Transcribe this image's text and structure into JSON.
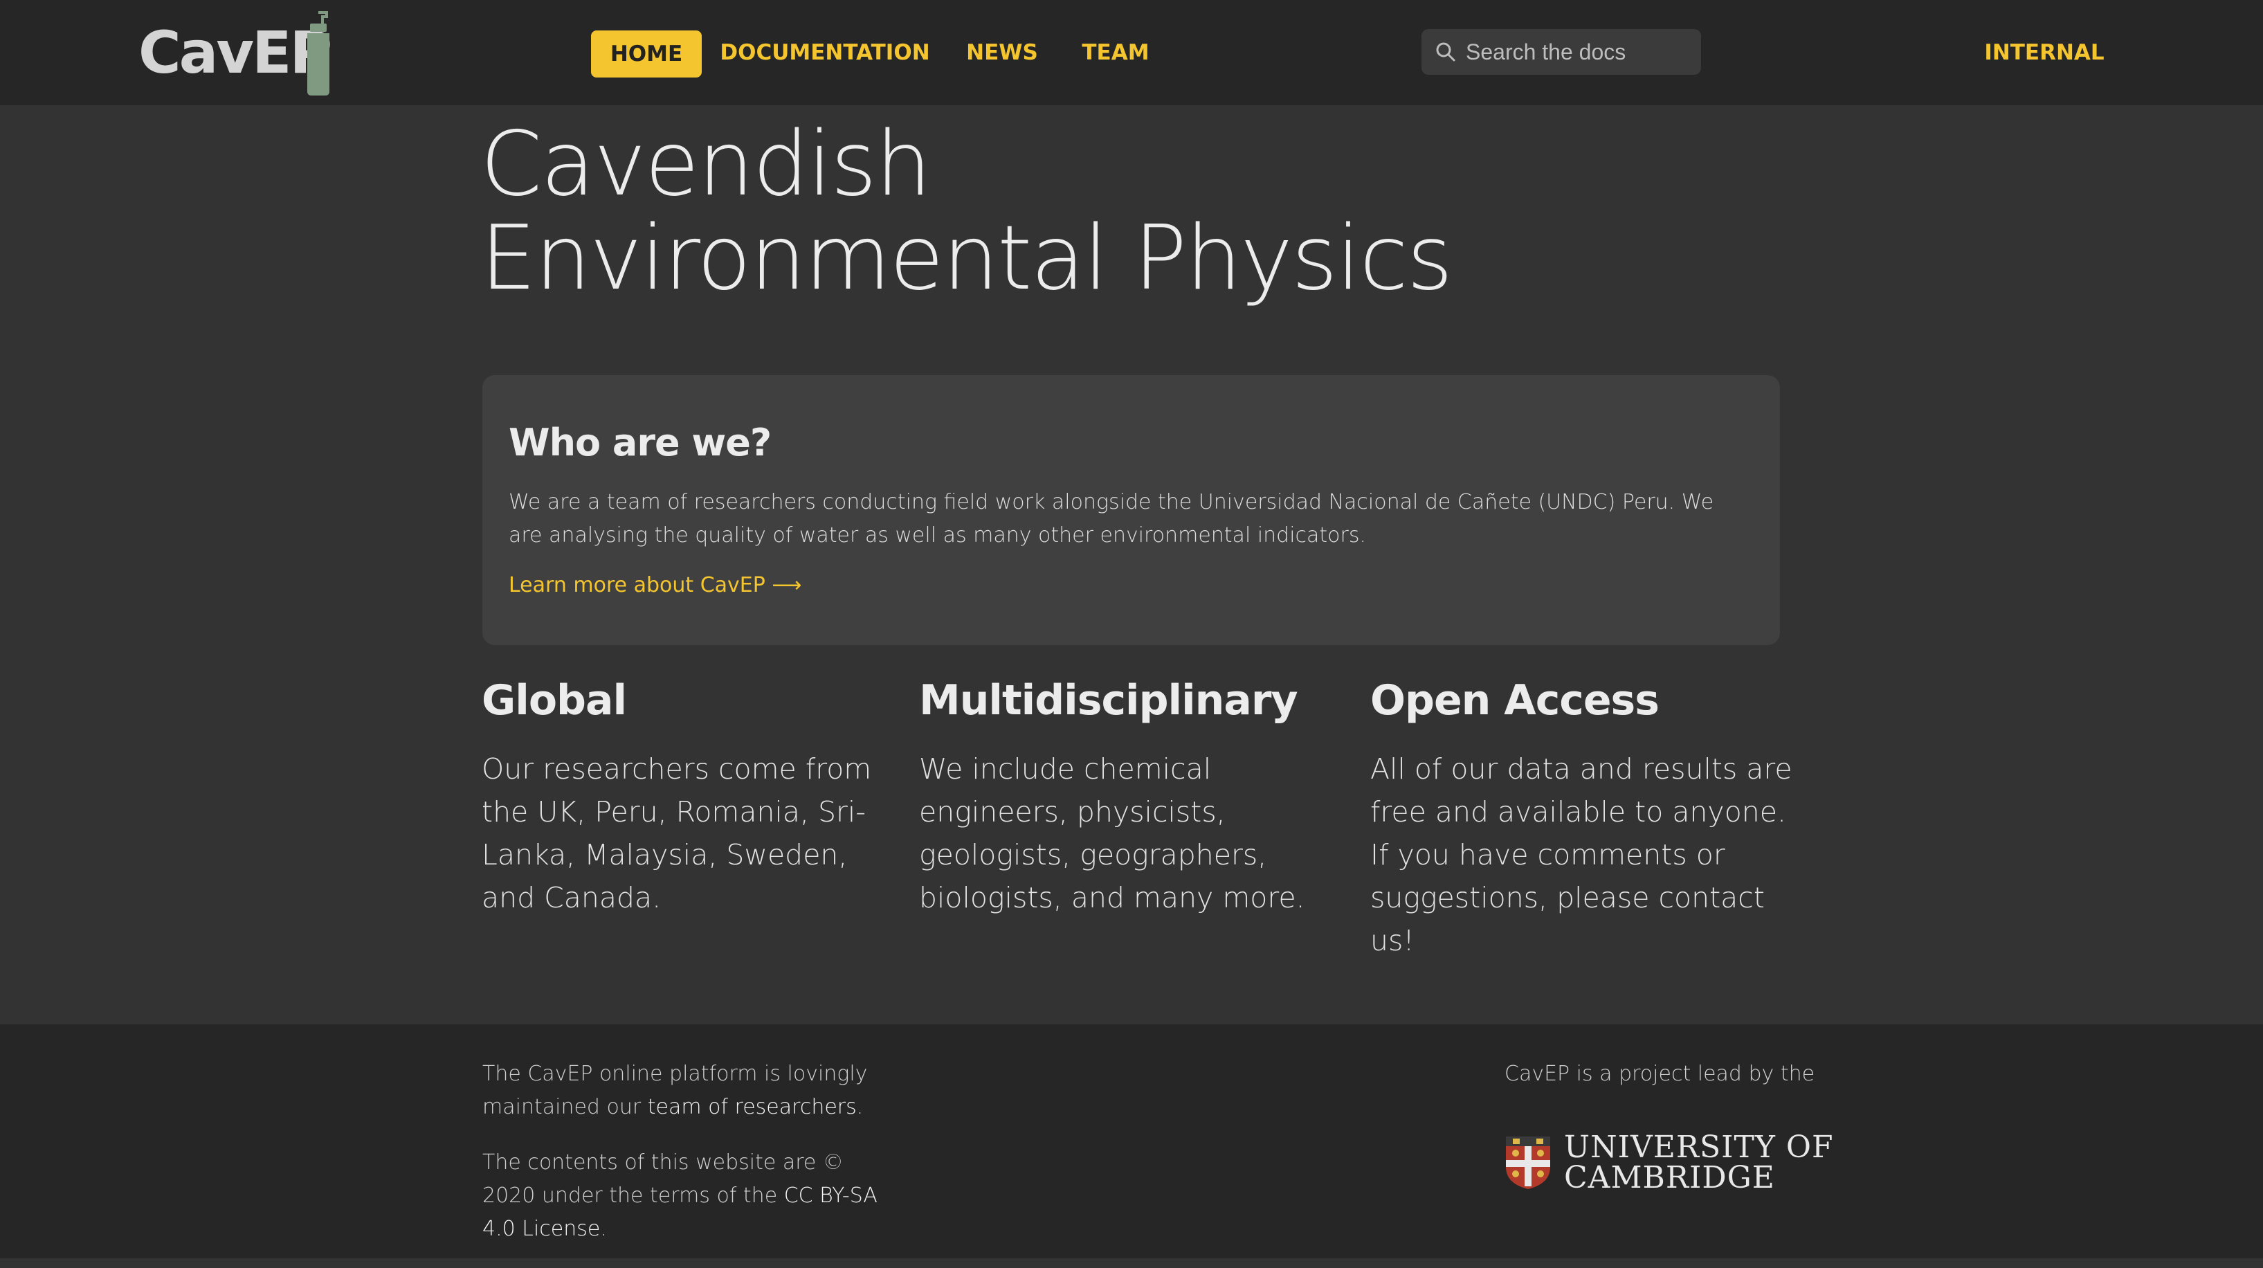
{
  "header": {
    "logo_text": "CavEP",
    "nav": {
      "home": "HOME",
      "documentation": "DOCUMENTATION",
      "news": "NEWS",
      "team": "TEAM",
      "internal": "INTERNAL"
    },
    "search": {
      "placeholder": "Search the docs"
    }
  },
  "hero": {
    "line1": "Cavendish",
    "line2": "Environmental Physics"
  },
  "about": {
    "title": "Who are we?",
    "body": "We are a team of researchers conducting field work alongside the Universidad Nacional de Cañete (UNDC) Peru. We are analysing the quality of water as well as many other environmental indicators.",
    "link": "Learn more about CavEP ⟶"
  },
  "features": [
    {
      "title": "Global",
      "body": "Our researchers come from the UK, Peru, Romania, Sri-Lanka, Malaysia, Sweden, and Canada."
    },
    {
      "title": "Multidisciplinary",
      "body": "We include chemical engineers, physicists, geologists, geographers, biologists, and many more."
    },
    {
      "title": "Open Access",
      "body": "All of our data and results are free and available to anyone. If you have comments or suggestions, please contact us!"
    }
  ],
  "footer": {
    "maintained_prefix": "The CavEP online platform is lovingly maintained our ",
    "maintained_link": "team of researchers",
    "maintained_suffix": ".",
    "license_prefix": "The contents of this website are © 2020 under the terms of the ",
    "license_link": "CC BY-SA 4.0 License",
    "license_suffix": ".",
    "lead_text": "CavEP is a project lead by the",
    "university_line1": "UNIVERSITY OF",
    "university_line2": "CAMBRIDGE"
  },
  "colors": {
    "accent": "#f4c52e",
    "background": "#333333",
    "header_bg": "#262626",
    "card_bg": "#404040"
  },
  "icons": {
    "search": "search-icon",
    "logo": "bottle-icon",
    "crest": "cambridge-crest-icon"
  }
}
